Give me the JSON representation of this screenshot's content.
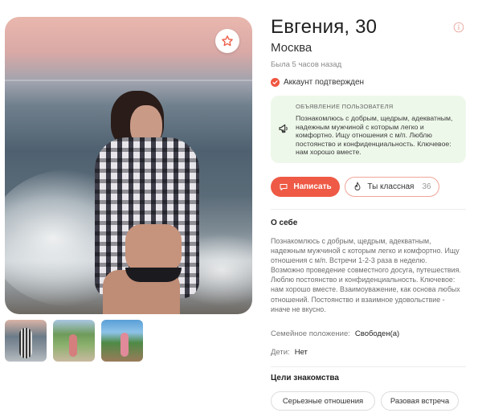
{
  "profile": {
    "name_age": "Евгения, 30",
    "city": "Москва",
    "last_seen": "Была 5 часов назад",
    "verified_label": "Аккаунт подтвержден"
  },
  "announcement": {
    "title": "Объявление пользователя",
    "text": "Познакомлюсь с добрым, щедрым, адекватным, надежным мужчиной с которым легко и комфортно. Ищу отношения с м/п. Люблю постоянство и конфиденциальность. Ключевое: нам хорошо вместе."
  },
  "actions": {
    "write_label": "Написать",
    "like_label": "Ты классная",
    "like_count": "36"
  },
  "about": {
    "title": "О себе",
    "text": "Познакомлюсь с добрым, щедрым, адекватным, надежным мужчиной с которым легко и комфортно. Ищу отношения с м/п. Встречи 1-2-3 раза в неделю. Возможно проведение совместного досуга, путешествия. Люблю постоянство и конфиденциальность. Ключевое: нам хорошо вместе. Взаимоуважение, как основа любых отношений. Постоянство и взаимное удовольствие - иначе не вкусно.",
    "family_label": "Семейное положение:",
    "family_value": "Свободен(а)",
    "kids_label": "Дети:",
    "kids_value": "Нет"
  },
  "goals": {
    "title": "Цели знакомства",
    "items": [
      "Серьезные отношения",
      "Разовая встреча"
    ]
  },
  "photos": {
    "thumbnail_count": 3
  },
  "colors": {
    "accent": "#ee5a45",
    "announcement_bg": "#eef8ea",
    "muted_text": "#6e6e6e"
  },
  "icons": {
    "favorite": "star-icon",
    "info": "info-icon",
    "verified": "check-circle-icon",
    "announcement": "megaphone-icon",
    "write": "chat-bubble-icon",
    "like": "flame-icon"
  }
}
